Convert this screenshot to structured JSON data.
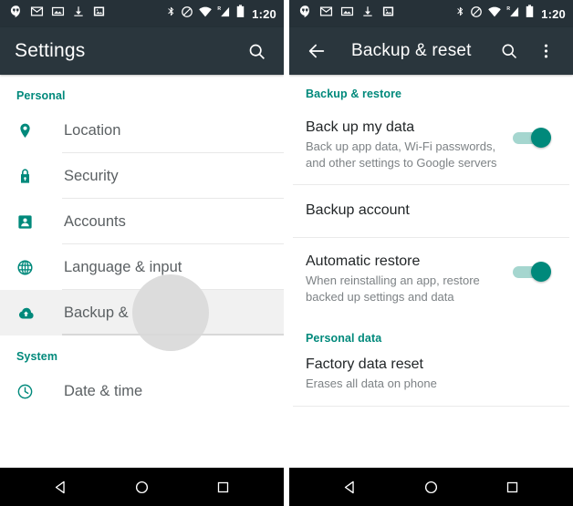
{
  "accent_color": "#00897b",
  "appbar_color": "#2a363d",
  "statusbar_color": "#263138",
  "statusbar": {
    "clock": "1:20",
    "notification_icons": [
      "hangouts-icon",
      "gmail-icon",
      "screenshot-icon",
      "download-icon",
      "photo-icon"
    ],
    "system_icons": [
      "bluetooth-icon",
      "do-not-disturb-icon",
      "wifi-icon",
      "roaming-signal-icon",
      "battery-icon"
    ]
  },
  "left_screen": {
    "appbar": {
      "title": "Settings",
      "search_icon": "search-icon"
    },
    "sections": [
      {
        "header": "Personal",
        "items": [
          {
            "label": "Location",
            "icon": "location-pin-icon",
            "selected": false
          },
          {
            "label": "Security",
            "icon": "lock-icon",
            "selected": false
          },
          {
            "label": "Accounts",
            "icon": "person-badge-icon",
            "selected": false
          },
          {
            "label": "Language & input",
            "icon": "globe-icon",
            "selected": false
          },
          {
            "label": "Backup & reset",
            "icon": "cloud-upload-icon",
            "selected": true
          }
        ]
      },
      {
        "header": "System",
        "items": [
          {
            "label": "Date & time",
            "icon": "clock-icon",
            "selected": false
          }
        ]
      }
    ]
  },
  "right_screen": {
    "appbar": {
      "title": "Backup & reset",
      "back_icon": "back-arrow-icon",
      "search_icon": "search-icon",
      "overflow_icon": "overflow-menu-icon"
    },
    "sections": [
      {
        "header": "Backup & restore",
        "items": [
          {
            "title": "Back up my data",
            "subtitle": "Back up app data, Wi-Fi passwords, and other settings to Google servers",
            "toggle": "on"
          },
          {
            "title": "Backup account",
            "subtitle": "",
            "toggle": "none"
          },
          {
            "title": "Automatic restore",
            "subtitle": "When reinstalling an app, restore backed up settings and data",
            "toggle": "on"
          }
        ]
      },
      {
        "header": "Personal data",
        "items": [
          {
            "title": "Factory data reset",
            "subtitle": "Erases all data on phone",
            "toggle": "none"
          }
        ]
      }
    ]
  },
  "navbar": {
    "back_label": "back-triangle-icon",
    "home_label": "home-circle-icon",
    "recents_label": "recents-square-icon"
  }
}
